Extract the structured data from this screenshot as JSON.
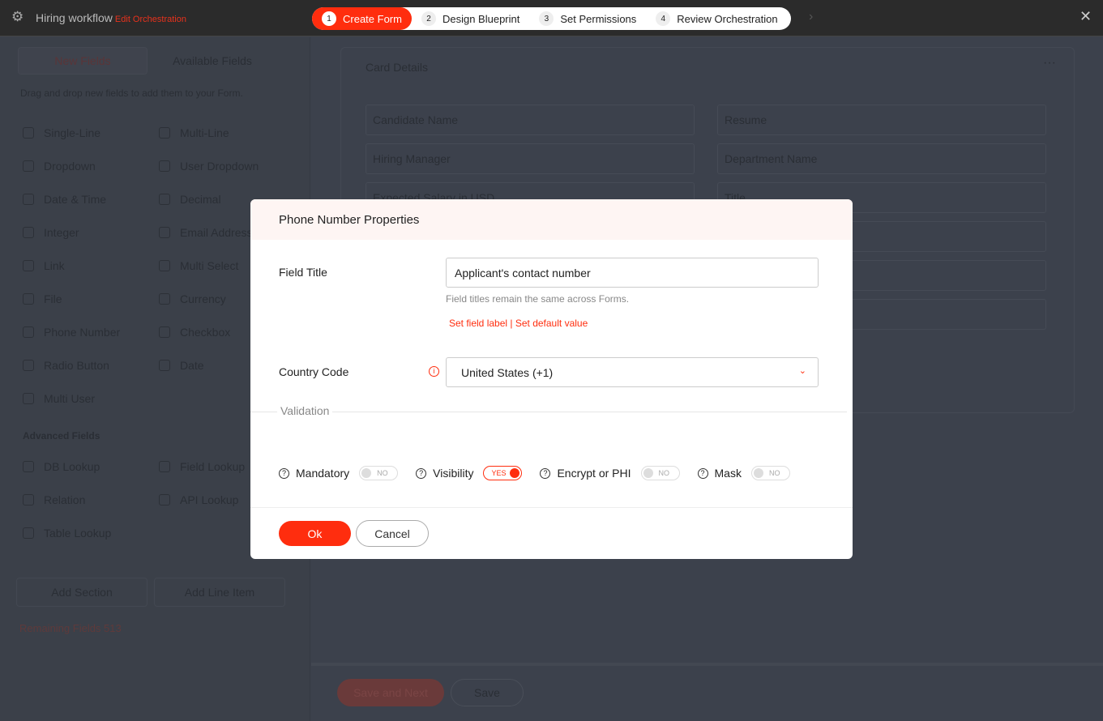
{
  "header": {
    "title": "Hiring workflow",
    "subtitle": "Edit Orchestration",
    "steps": [
      {
        "num": "1",
        "label": "Create Form"
      },
      {
        "num": "2",
        "label": "Design Blueprint"
      },
      {
        "num": "3",
        "label": "Set Permissions"
      },
      {
        "num": "4",
        "label": "Review Orchestration"
      }
    ]
  },
  "left": {
    "tabs": [
      "New Fields",
      "Available Fields"
    ],
    "hint": "Drag and drop new fields to add them to your Form.",
    "fields": [
      "Single-Line",
      "Multi-Line",
      "Dropdown",
      "User Dropdown",
      "Date & Time",
      "Decimal",
      "Integer",
      "Email Address",
      "Link",
      "Multi Select",
      "File",
      "Currency",
      "Phone Number",
      "Checkbox",
      "Radio Button",
      "Date",
      "Multi User"
    ],
    "advanced_title": "Advanced Fields",
    "advanced": [
      "DB Lookup",
      "Field Lookup",
      "Relation",
      "API Lookup",
      "Table Lookup"
    ],
    "add_section": "Add Section",
    "add_line_item": "Add Line Item",
    "remaining": "Remaining Fields 513"
  },
  "card": {
    "title": "Card Details",
    "more": "···",
    "fields": [
      "Candidate Name",
      "Resume",
      "Hiring Manager",
      "Department Name",
      "Expected Salary in USD",
      "Title"
    ]
  },
  "footer": {
    "save_next": "Save and Next",
    "save": "Save"
  },
  "modal": {
    "title": "Phone Number Properties",
    "field_title_label": "Field Title",
    "field_title_value": "Applicant's contact number",
    "help": "Field titles remain the same across Forms.",
    "link1": "Set field label",
    "sep": "|",
    "link2": "Set default value",
    "country_label": "Country Code",
    "country_value": "United States (+1)",
    "validation": "Validation",
    "toggles": [
      {
        "label": "Mandatory",
        "state": "NO"
      },
      {
        "label": "Visibility",
        "state": "YES"
      },
      {
        "label": "Encrypt or PHI",
        "state": "NO"
      },
      {
        "label": "Mask",
        "state": "NO"
      }
    ],
    "ok": "Ok",
    "cancel": "Cancel"
  },
  "colors": {
    "accent": "#ff2d0e"
  }
}
